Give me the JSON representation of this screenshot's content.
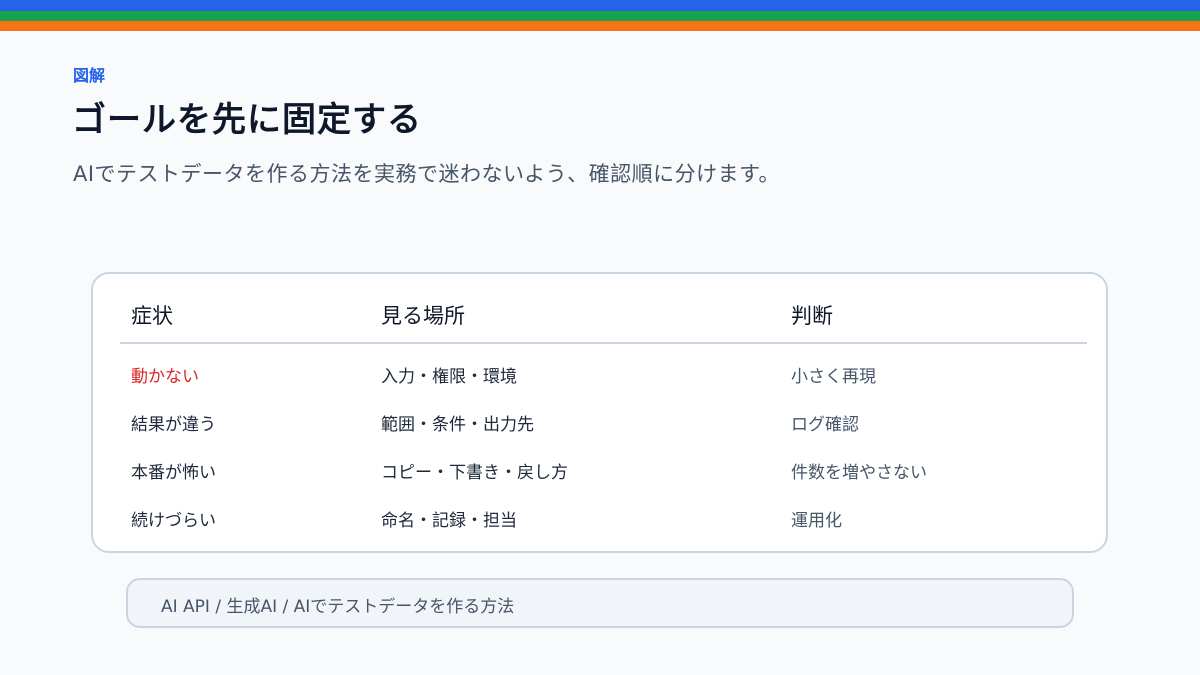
{
  "colors": {
    "stripe_blue": "#2563eb",
    "stripe_green": "#16a34a",
    "stripe_orange": "#f97316",
    "accent": "#2563eb",
    "alert": "#dc2626"
  },
  "header": {
    "eyebrow": "図解",
    "title": "ゴールを先に固定する",
    "subtitle": "AIでテストデータを作る方法を実務で迷わないよう、確認順に分けます。"
  },
  "table": {
    "columns": [
      "症状",
      "見る場所",
      "判断"
    ],
    "rows": [
      [
        "動かない",
        "入力・権限・環境",
        "小さく再現"
      ],
      [
        "結果が違う",
        "範囲・条件・出力先",
        "ログ確認"
      ],
      [
        "本番が怖い",
        "コピー・下書き・戻し方",
        "件数を増やさない"
      ],
      [
        "続けづらい",
        "命名・記録・担当",
        "運用化"
      ]
    ]
  },
  "breadcrumb": {
    "text": "AI API / 生成AI / AIでテストデータを作る方法"
  }
}
